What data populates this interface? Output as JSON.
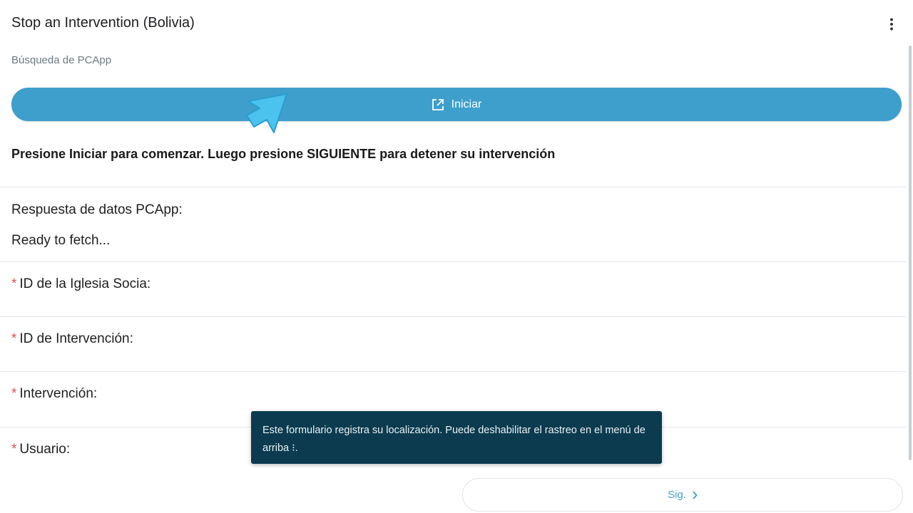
{
  "header": {
    "title": "Stop an Intervention (Bolivia)",
    "menu_icon": "more-vert-icon"
  },
  "form": {
    "subtitle": "Búsqueda de PCApp",
    "start_button": {
      "label": "Iniciar",
      "icon": "open-in-new-icon"
    },
    "instruction": "Presione Iniciar para comenzar. Luego presione SIGUIENTE para detener su intervención",
    "response": {
      "label": "Respuesta de datos PCApp:",
      "value": "Ready to fetch..."
    },
    "fields": [
      {
        "required_mark": "*",
        "label": "ID de la Iglesia Socia:"
      },
      {
        "required_mark": "*",
        "label": "ID de Intervención:"
      },
      {
        "required_mark": "*",
        "label": "Intervención:"
      },
      {
        "required_mark": "*",
        "label": "Usuario:"
      }
    ]
  },
  "toast": {
    "message": "Este formulario registra su localización. Puede deshabilitar el rastreo en el menú de arriba ⁝."
  },
  "footer": {
    "next_label": "Sig.",
    "next_icon": "chevron-right-icon"
  },
  "colors": {
    "accent": "#3e9fcc",
    "toast_bg": "#0c3b4f",
    "required": "#d9534f",
    "pointer": "#4cc3ef"
  }
}
